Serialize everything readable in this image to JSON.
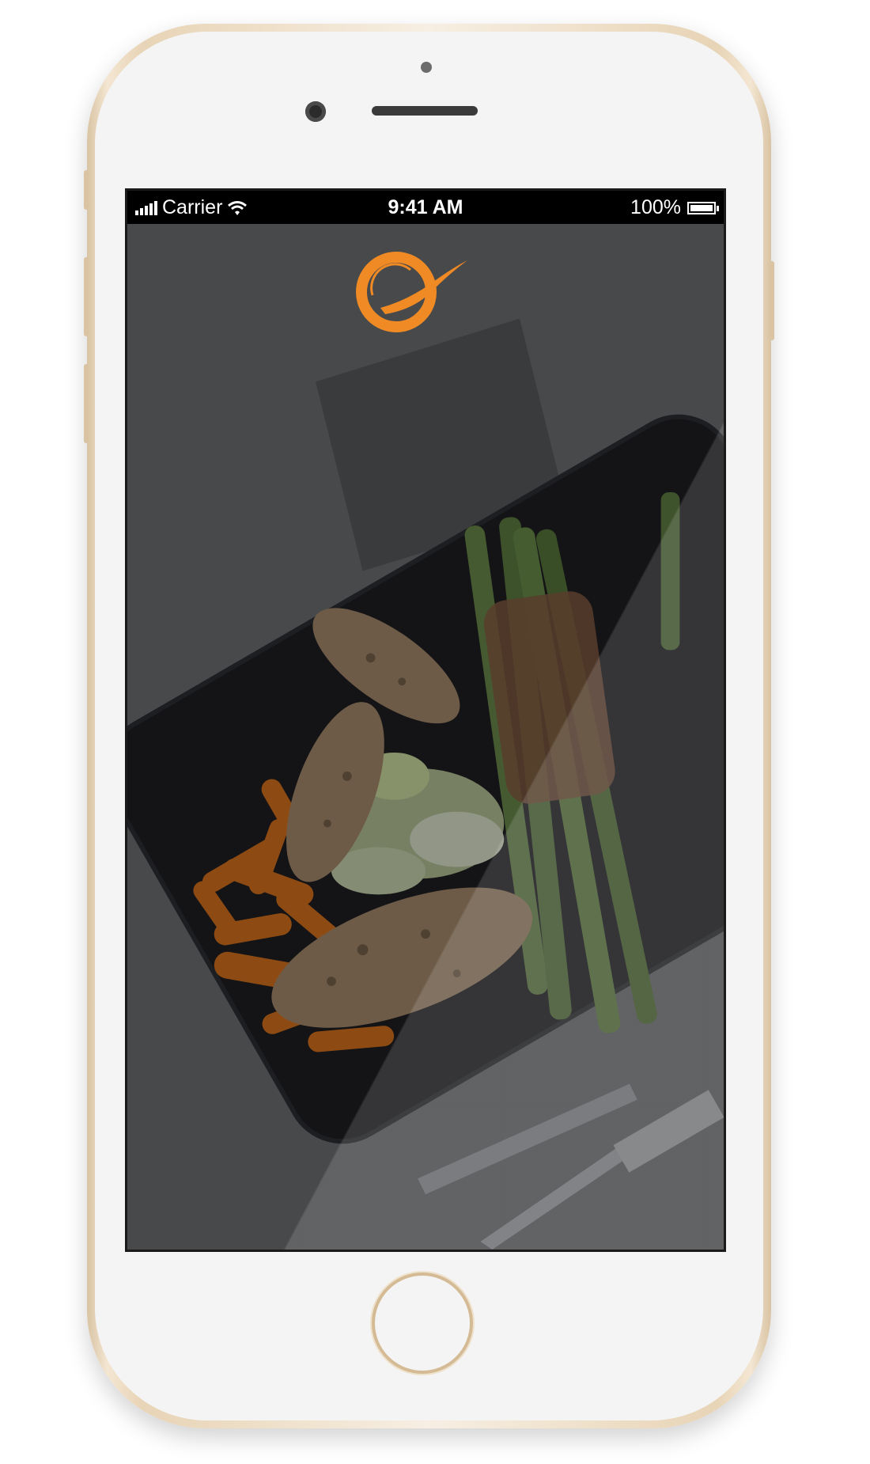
{
  "device": {
    "model": "iphone-gold"
  },
  "status_bar": {
    "carrier": "Carrier",
    "time": "9:41 AM",
    "battery_text": "100%",
    "battery_level": 1.0,
    "signal_bars": 5
  },
  "splash": {
    "logo_icon": "plate-spoon-logo-icon",
    "accent_color": "#f08a24",
    "background_image": "food-plate-photo"
  }
}
